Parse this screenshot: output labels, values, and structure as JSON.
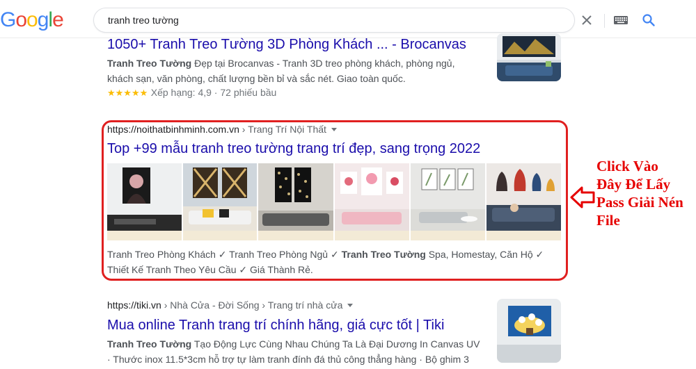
{
  "logo": {
    "letters": [
      "G",
      "o",
      "o",
      "g",
      "l",
      "e"
    ],
    "colors": [
      "#4285F4",
      "#EA4335",
      "#FBBC05",
      "#4285F4",
      "#34A853",
      "#EA4335"
    ]
  },
  "search": {
    "value": "tranh treo tường"
  },
  "results": [
    {
      "title": "1050+ Tranh Treo Tường 3D Phòng Khách ... - Brocanvas",
      "snippet_bold": "Tranh Treo Tường",
      "snippet_line1_rest": " Đẹp tại Brocanvas - Tranh 3D treo phòng khách, phòng ngủ,",
      "snippet_line2": "khách sạn, văn phòng, chất lượng bền bỉ và sắc nét. Giao toàn quốc.",
      "stars": "★★★★★",
      "rating": "Xếp hạng: 4,9 · 72 phiếu bầu"
    },
    {
      "url": "https://noithatbinhminh.com.vn",
      "breadcrumb": " › Trang Trí Nội Thất",
      "title": "Top +99 mẫu tranh treo tường trang trí đẹp, sang trọng 2022",
      "snippet_line1_a": "Tranh Treo Phòng Khách ✓ Tranh Treo Phòng Ngủ ✓ ",
      "snippet_line1_bold": "Tranh Treo Tường",
      "snippet_line1_b": " Spa, Homestay, Căn Hộ ✓",
      "snippet_line2": "Thiết Kế Tranh Theo Yêu Cầu ✓ Giá Thành Rẻ."
    },
    {
      "url": "https://tiki.vn",
      "breadcrumb": " › Nhà Cửa - Đời Sống › Trang trí nhà cửa",
      "title": "Mua online Tranh trang trí chính hãng, giá cực tốt | Tiki",
      "snippet_bold": "Tranh Treo Tường",
      "snippet_line1_rest": " Tạo Động Lực Cùng Nhau Chúng Ta Là Đại Dương In Canvas UV",
      "snippet_line2": "· Thước inox 11.5*3cm hỗ trợ tự làm tranh đính đá thủ công thẳng hàng · Bộ ghim 3"
    }
  ],
  "annotation": {
    "lines": [
      "Click Vào",
      "Đây Để Lấy",
      "Pass Giải Nén",
      "File"
    ],
    "color": "#e60000"
  },
  "icons": [
    "clear-icon",
    "keyboard-icon",
    "search-icon",
    "dropdown-caret-icon",
    "left-arrow-icon"
  ]
}
